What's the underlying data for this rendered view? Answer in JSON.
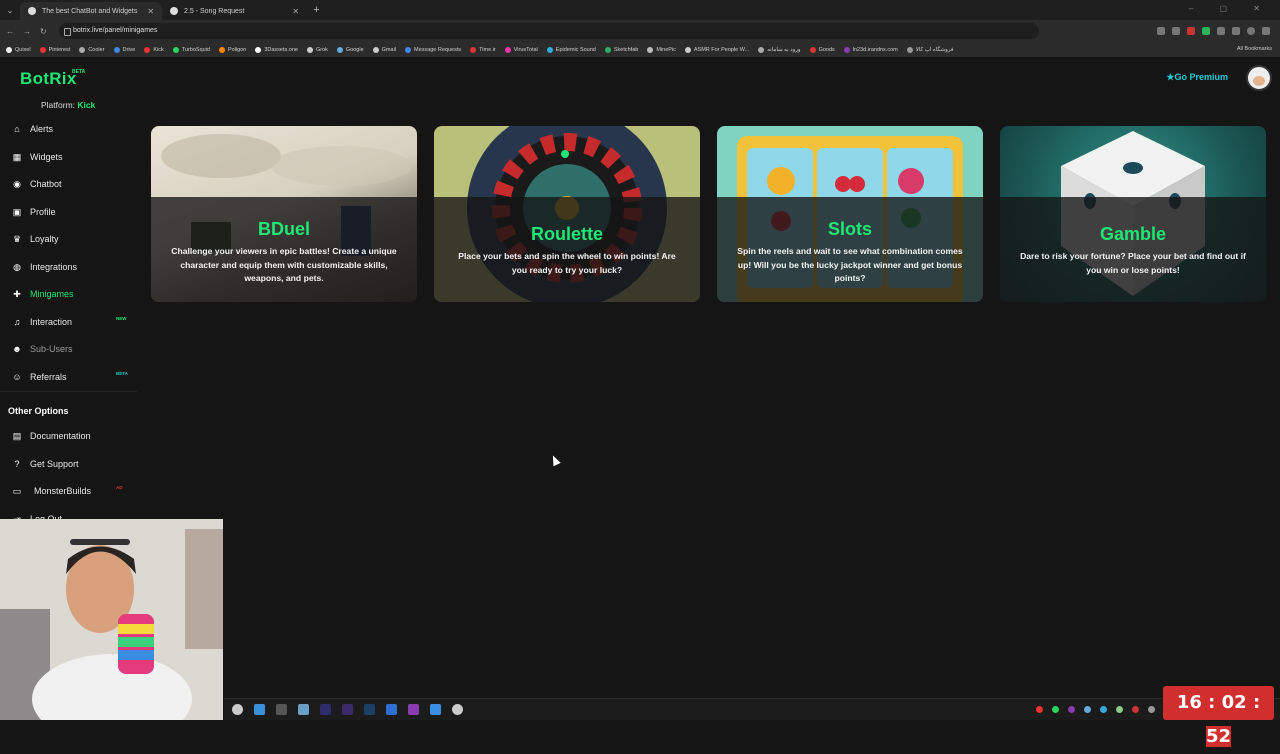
{
  "browser": {
    "tabs": [
      {
        "title": "The best ChatBot and Widgets",
        "active": true
      },
      {
        "title": "2.5 - Song Request",
        "active": false
      }
    ],
    "url": "botrix.live/panel/minigames",
    "bookmarks": [
      "Quixel",
      "Pinterest",
      "Cooler",
      "Drive",
      "Kick",
      "TurboSquid",
      "Poligon",
      "3Dassets.one",
      "Grok",
      "Google",
      "Gmail",
      "Message Requests",
      "Time.ir",
      "VirusTotal",
      "Epidemic Sound",
      "Sketchfab",
      "MinePic",
      "ASMR For People W...",
      "ورود به سامانه",
      "Goods",
      "ln23d.irandns.com",
      "فروشگاه اپ کالا"
    ],
    "all_bookmarks": "All Bookmarks"
  },
  "app": {
    "logo": "BotRix",
    "logo_badge": "BETA",
    "platform_label": "Platform:",
    "platform_value": "Kick",
    "premium": "Go Premium"
  },
  "sidebar": {
    "items": [
      {
        "label": "Alerts",
        "icon": "home-icon"
      },
      {
        "label": "Widgets",
        "icon": "grid-icon"
      },
      {
        "label": "Chatbot",
        "icon": "robot-icon"
      },
      {
        "label": "Profile",
        "icon": "id-card-icon"
      },
      {
        "label": "Loyalty",
        "icon": "trophy-icon"
      },
      {
        "label": "Integrations",
        "icon": "globe-icon"
      },
      {
        "label": "Minigames",
        "icon": "gamepad-icon"
      },
      {
        "label": "Interaction",
        "icon": "music-icon",
        "badge": "NEW"
      },
      {
        "label": "Sub-Users",
        "icon": "users-icon"
      },
      {
        "label": "Referrals",
        "icon": "user-group-icon",
        "badge": "BETA"
      }
    ],
    "other_title": "Other Options",
    "other_items": [
      {
        "label": "Documentation",
        "icon": "book-icon"
      },
      {
        "label": "Get Support",
        "icon": "question-icon"
      },
      {
        "label": "MonsterBuilds",
        "icon": "laptop-icon",
        "badge": "AD"
      },
      {
        "label": "Log Out",
        "icon": "logout-icon"
      }
    ]
  },
  "minigames": [
    {
      "title": "BDuel",
      "description": "Challenge your viewers in epic battles! Create a unique character and equip them with customizable skills, weapons, and pets."
    },
    {
      "title": "Roulette",
      "description": "Place your bets and spin the wheel to win points! Are you ready to try your luck?"
    },
    {
      "title": "Slots",
      "description": "Spin the reels and wait to see what combination comes up! Will you be the lucky jackpot winner and get bonus points?"
    },
    {
      "title": "Gamble",
      "description": "Dare to risk your fortune? Place your bet and find out if you win or lose points!"
    }
  ],
  "clock": {
    "hours": "16",
    "minutes": "02",
    "seconds": "52"
  },
  "colors": {
    "accent": "#1ee873",
    "premium": "#1ecbd6",
    "clock_bg": "#d12e2e",
    "background": "#151515"
  }
}
